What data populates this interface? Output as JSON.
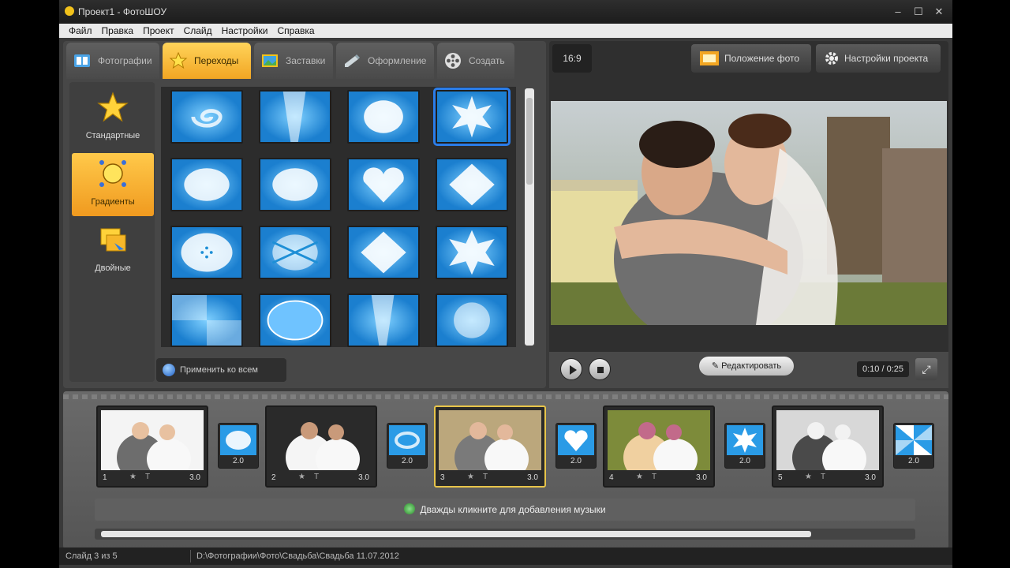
{
  "window": {
    "title": "Проект1 - ФотоШОУ",
    "minimize": "–",
    "maximize": "☐",
    "close": "✕"
  },
  "menu": [
    "Файл",
    "Правка",
    "Проект",
    "Слайд",
    "Настройки",
    "Справка"
  ],
  "tabs": [
    {
      "label": "Фотографии",
      "icon": "photos-icon",
      "active": false
    },
    {
      "label": "Переходы",
      "icon": "star-icon",
      "active": true
    },
    {
      "label": "Заставки",
      "icon": "picture-icon",
      "active": false
    },
    {
      "label": "Оформление",
      "icon": "pen-icon",
      "active": false
    },
    {
      "label": "Создать",
      "icon": "film-reel-icon",
      "active": false
    }
  ],
  "categories": [
    {
      "label": "Стандартные",
      "icon": "star-icon",
      "active": false
    },
    {
      "label": "Градиенты",
      "icon": "sun-icon",
      "active": true
    },
    {
      "label": "Двойные",
      "icon": "double-icon",
      "active": false
    }
  ],
  "apply_all": "Применить ко всем",
  "right_toolbar": {
    "aspect": "16:9",
    "photo_position": "Положение фото",
    "project_settings": "Настройки проекта"
  },
  "player": {
    "edit": "Редактировать",
    "time": "0:10 / 0:25",
    "fullscreen_icon": "⤢"
  },
  "slides": [
    {
      "num": "1",
      "duration": "3.0"
    },
    {
      "num": "2",
      "duration": "3.0"
    },
    {
      "num": "3",
      "duration": "3.0",
      "current": true
    },
    {
      "num": "4",
      "duration": "3.0"
    },
    {
      "num": "5",
      "duration": "3.0"
    }
  ],
  "transitions": [
    "2.0",
    "2.0",
    "2.0",
    "2.0",
    "2.0"
  ],
  "music_hint": "Дважды кликните для добавления музыки",
  "status": {
    "slide": "Слайд 3 из 5",
    "path": "D:\\Фотографии\\Фото\\Свадьба\\Свадьба 11.07.2012"
  },
  "colors": {
    "accent": "#f2a623",
    "selection": "#2b7de9",
    "tile_blue": "#1e8fd6"
  }
}
